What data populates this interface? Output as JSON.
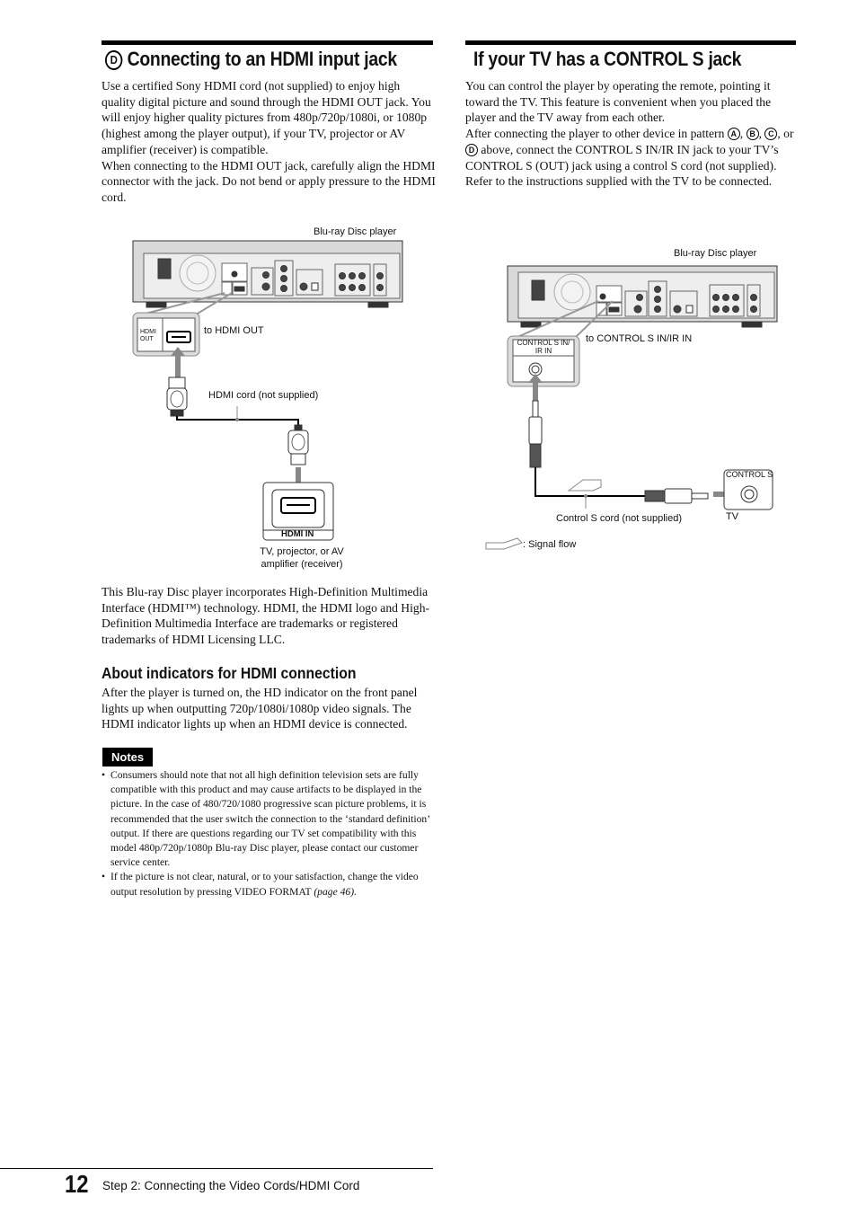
{
  "left": {
    "heading_marker": "D",
    "heading": "Connecting to an HDMI input jack",
    "intro_p1": "Use a certified Sony HDMI cord (not supplied) to enjoy high quality digital picture and sound through the HDMI OUT jack. You will enjoy higher quality pictures from 480p/720p/1080i, or 1080p (highest among the player output), if your TV, projector or AV amplifier (receiver) is compatible.",
    "intro_p2": "When connecting to the HDMI OUT jack, carefully align the HDMI connector with the jack. Do not bend or apply pressure to the HDMI cord.",
    "diagram": {
      "player_label": "Blu-ray Disc player",
      "jack_label": "HDMI OUT",
      "to_label": "to HDMI OUT",
      "cord_label": "HDMI cord (not supplied)",
      "in_label": "HDMI IN",
      "device_label": "TV, projector, or AV amplifier (receiver)"
    },
    "trademark": "This Blu-ray Disc player incorporates High-Definition Multimedia Interface (HDMI™) technology. HDMI, the HDMI logo and High-Definition Multimedia Interface are trademarks or registered trademarks of HDMI Licensing LLC.",
    "indicators_heading": "About indicators for HDMI connection",
    "indicators_text": "After the player is turned on, the HD indicator on the front panel lights up when outputting 720p/1080i/1080p video signals. The HDMI indicator lights up when an HDMI device is connected.",
    "notes_label": "Notes",
    "notes": [
      "Consumers should note that not all high definition television sets are fully compatible with this product and may cause artifacts to be displayed in the picture. In the case of 480/720/1080 progressive scan picture problems, it is recommended that the user switch the connection to the ‘standard definition’ output. If there are questions regarding our TV set compatibility with this model 480p/720p/1080p Blu-ray Disc player, please contact our customer service center.",
      "If the picture is not clear, natural, or to your satisfaction, change the video output resolution by pressing VIDEO FORMAT"
    ],
    "note2_ref": "(page 46)."
  },
  "right": {
    "heading": "If your TV has a CONTROL S jack",
    "p1": "You can control the player by operating the remote, pointing it toward the TV. This feature is convenient when you placed the player and the TV away from each other.",
    "p2_a": "After connecting the player to other device in pattern ",
    "p2_markers": [
      "A",
      "B",
      "C",
      "D"
    ],
    "p2_b": " above, connect the CONTROL S IN/IR IN jack to your TV’s CONTROL S (OUT) jack using a control S cord (not supplied). Refer to the instructions supplied with the TV to be connected.",
    "diagram": {
      "player_label": "Blu-ray Disc player",
      "jack_label": "CONTROL S IN/ IR IN",
      "to_label": "to CONTROL S IN/IR IN",
      "cord_label": "Control S cord (not supplied)",
      "tv_jack_label": "CONTROL S",
      "tv_label": "TV",
      "legend_label": ": Signal flow"
    }
  },
  "footer": {
    "page_number": "12",
    "section": "Step 2: Connecting the Video Cords/HDMI Cord"
  }
}
